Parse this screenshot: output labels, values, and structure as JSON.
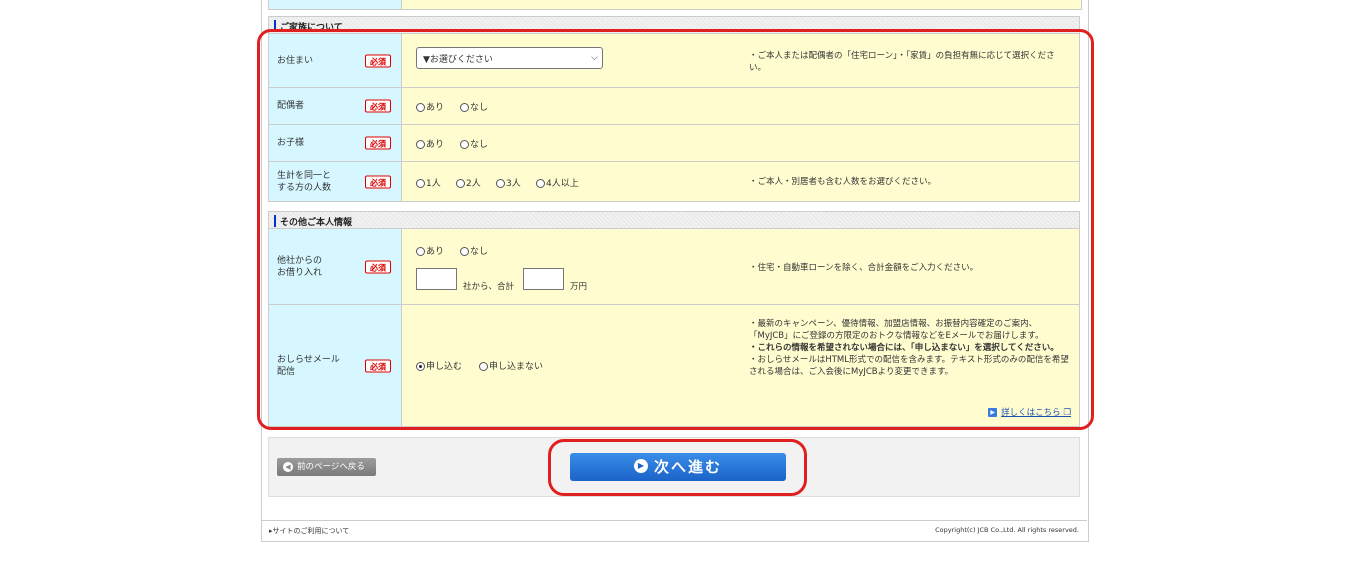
{
  "section1": {
    "title": "ご家族について"
  },
  "section2": {
    "title": "その他ご本人情報"
  },
  "required_badge": "必須",
  "rows": {
    "residence": {
      "label": "お住まい",
      "select_value": "▼お選びください",
      "note": "・ご本人または配偶者の「住宅ローン」・「家賃」の負担有無に応じて選択ください。"
    },
    "spouse": {
      "label": "配偶者",
      "options": [
        "あり",
        "なし"
      ]
    },
    "children": {
      "label": "お子様",
      "options": [
        "あり",
        "なし"
      ]
    },
    "household": {
      "label": "生計を同一と\nする方の人数",
      "options": [
        "1人",
        "2人",
        "3人",
        "4人以上"
      ],
      "note": "・ご本人・別居者も含む人数をお選びください。"
    },
    "loans": {
      "label": "他社からの\nお借り入れ",
      "options": [
        "あり",
        "なし"
      ],
      "unit1": "社から、合計",
      "unit2": "万円",
      "note": "・住宅・自動車ローンを除く、合計金額をご入力ください。"
    },
    "mail": {
      "label": "おしらせメール\n配信",
      "options": [
        "申し込む",
        "申し込まない"
      ],
      "selected": "申し込む",
      "note1": "・最新のキャンペーン、優待情報、加盟店情報、お振替内容確定のご案内、「MyJCB」にご登録の方限定のおトクな情報などをEメールでお届けします。",
      "note2": "・これらの情報を希望されない場合には、「申し込まない」を選択してください。",
      "note3": "・おしらせメールはHTML形式での配信を含みます。テキスト形式のみの配信を希望される場合は、ご入会後にMyJCBより変更できます。",
      "link": "詳しくはこちら"
    }
  },
  "nav": {
    "back": "前のページへ戻る",
    "next": "次へ進む"
  },
  "footer": {
    "left": "▸サイトのご利用について",
    "right": "Copyright(c) JCB Co.,Ltd. All rights reserved."
  },
  "colors": {
    "highlight": "#e02020",
    "label_bg": "#d6f7ff",
    "field_bg": "#fffdd0",
    "primary": "#1b63c9"
  }
}
